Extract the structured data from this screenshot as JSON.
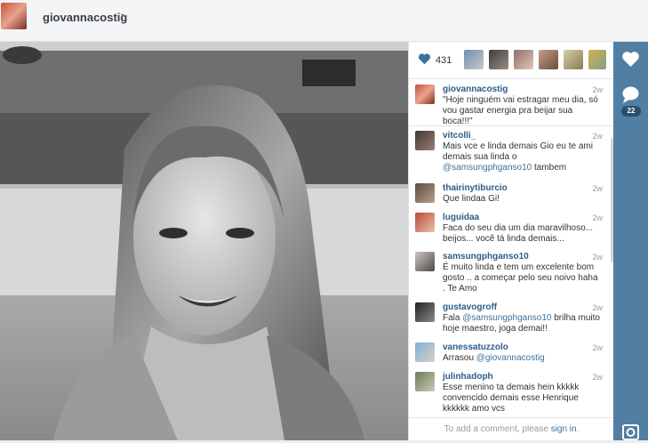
{
  "header": {
    "username": "giovannacostig",
    "caret": "▾"
  },
  "post": {
    "likes": "431",
    "caption": {
      "user": "giovannacostig",
      "time": "2w",
      "text": "\"Hoje ninguém vai estragar meu dia, só vou gastar energia pra beijar sua boca!!!\""
    },
    "comments": [
      {
        "user": "vitcolli_",
        "time": "2w",
        "text_before": "Mais vce e linda demais Gio eu te ami demais sua linda o ",
        "mention": "@samsungphganso10",
        "text_after": " tambem"
      },
      {
        "user": "thairinytiburcio",
        "time": "2w",
        "text_before": "Que lindaa Gi!",
        "mention": "",
        "text_after": ""
      },
      {
        "user": "luguidaa",
        "time": "2w",
        "text_before": "Faca do seu dia um dia maravilhoso... beijos... você tá linda demais...",
        "mention": "",
        "text_after": ""
      },
      {
        "user": "samsungphganso10",
        "time": "2w",
        "text_before": "É muito linda e tem um excelente bom gosto .. a começar pelo seu noivo haha . Te Amo",
        "mention": "",
        "text_after": ""
      },
      {
        "user": "gustavogroff",
        "time": "2w",
        "text_before": "Fala ",
        "mention": "@samsungphganso10",
        "text_after": " brilha muito hoje maestro, joga demai!!"
      },
      {
        "user": "vanessatuzzolo",
        "time": "2w",
        "text_before": "Arrasou ",
        "mention": "@giovannacostig",
        "text_after": ""
      },
      {
        "user": "julinhadoph",
        "time": "2w",
        "text_before": "Esse menino ta demais hein kkkkk convencido demais esse Henrique kkkkkk amo vcs",
        "mention": "",
        "text_after": ""
      }
    ],
    "add_comment": {
      "prefix": "To add a comment, please ",
      "link": "sign in",
      "suffix": "."
    }
  },
  "rail": {
    "like_icon": "heart-icon",
    "comment_icon": "speech-bubble-icon",
    "comment_count": "22",
    "camera_icon": "camera-icon"
  },
  "colors": {
    "link": "#3f729b",
    "username": "#2d5c88",
    "rail": "#517fa4",
    "heart": "#3f729b"
  }
}
